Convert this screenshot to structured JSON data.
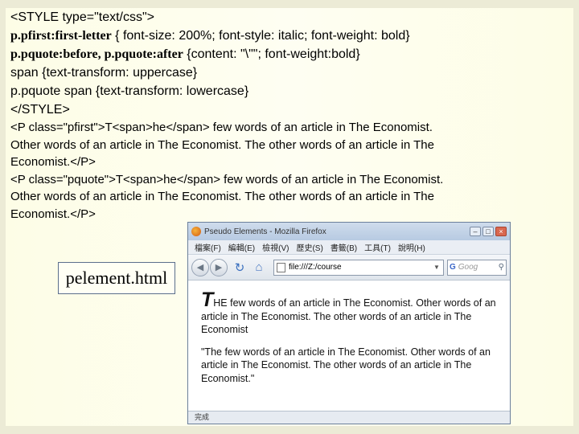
{
  "code_lines": [
    {
      "text": "<STYLE type=\"text/css\">"
    },
    {
      "selector": "p.pfirst:first-letter",
      "text": " { font-size: 200%; font-style: italic; font-weight: bold}"
    },
    {
      "selector": "p.pquote:before, p.pquote:after",
      "text": " {content: \"\\\"\"; font-weight:bold}"
    },
    {
      "text": "span {text-transform: uppercase}"
    },
    {
      "text": "p.pquote span {text-transform: lowercase}"
    },
    {
      "text": "</STYLE>"
    },
    {
      "text": "<P class=\"pfirst\">T<span>he</span> few words of an article in The Economist."
    },
    {
      "text": "Other words of an article in The Economist. The other words of an article in The"
    },
    {
      "text": "Economist.</P>"
    },
    {
      "text": "<P class=\"pquote\">T<span>he</span> few words of an article in The Economist."
    },
    {
      "text": "Other words of an article in The Economist. The other words of an article in  The"
    },
    {
      "text": "Economist.</P>"
    }
  ],
  "file_link": "pelement.html",
  "browser": {
    "title": "Pseudo Elements - Mozilla Firefox",
    "menus": [
      "檔案(F)",
      "編輯(E)",
      "檢視(V)",
      "歷史(S)",
      "書籤(B)",
      "工具(T)",
      "說明(H)"
    ],
    "url": "file:///Z:/course",
    "search_placeholder": "Goog",
    "para1_rest": "HE few words of an article in The Economist. Other words of an article in The Economist. The other words of an article in The Economist",
    "para2": "\"The few words of an article in The Economist. Other words of an article in The Economist. The other words of an article in The Economist.\"",
    "status": "完成"
  }
}
